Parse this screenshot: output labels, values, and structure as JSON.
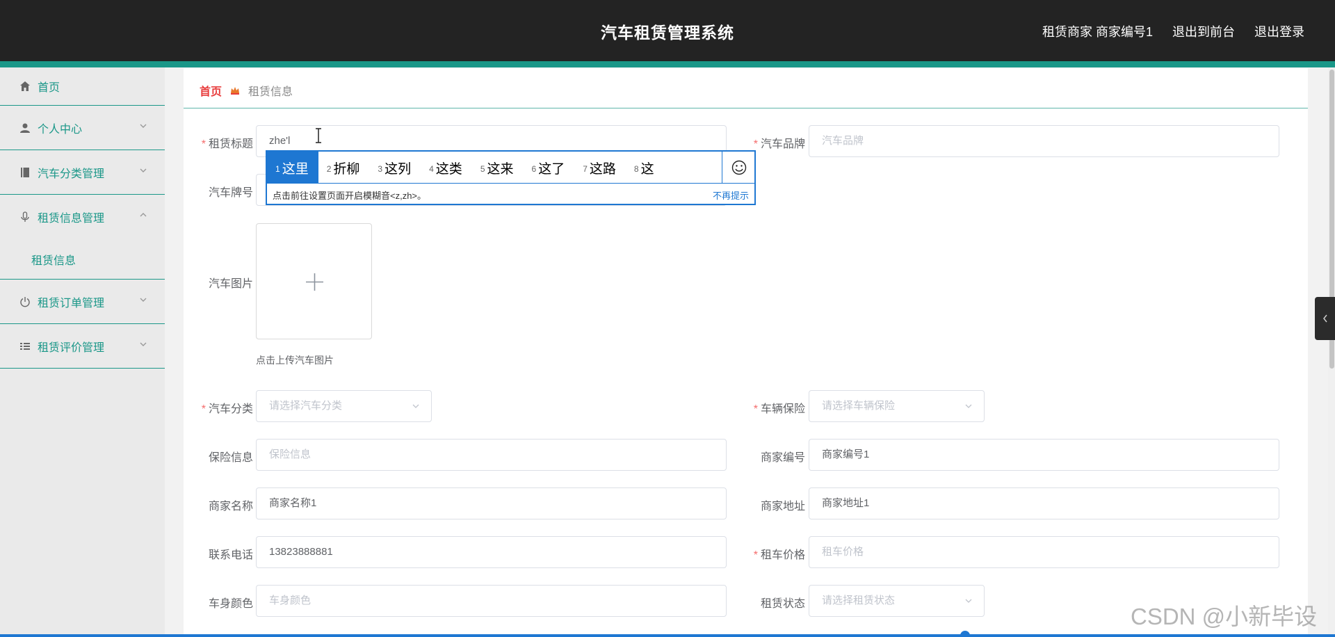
{
  "header": {
    "title": "汽车租赁管理系统",
    "user_label": "租赁商家 商家编号1",
    "to_front_label": "退出到前台",
    "logout_label": "退出登录"
  },
  "sidebar": {
    "items": [
      {
        "label": "首页",
        "icon": "home-icon"
      },
      {
        "label": "个人中心",
        "icon": "user-icon"
      },
      {
        "label": "汽车分类管理",
        "icon": "book-icon"
      },
      {
        "label": "租赁信息管理",
        "icon": "microphone-icon",
        "expanded": true,
        "children": [
          "租赁信息"
        ]
      },
      {
        "label": "租赁订单管理",
        "icon": "power-icon"
      },
      {
        "label": "租赁评价管理",
        "icon": "list-icon"
      }
    ]
  },
  "breadcrumb": {
    "home": "首页",
    "current": "租赁信息"
  },
  "form": {
    "title_label": "租赁标题",
    "title_value": "zhe'l",
    "brand_label": "汽车品牌",
    "brand_placeholder": "汽车品牌",
    "plate_label": "汽车牌号",
    "image_label": "汽车图片",
    "image_tip": "点击上传汽车图片",
    "category_label": "汽车分类",
    "category_placeholder": "请选择汽车分类",
    "insurance_label": "车辆保险",
    "insurance_placeholder": "请选择车辆保险",
    "insurance_info_label": "保险信息",
    "insurance_info_placeholder": "保险信息",
    "merchant_no_label": "商家编号",
    "merchant_no_value": "商家编号1",
    "merchant_name_label": "商家名称",
    "merchant_name_value": "商家名称1",
    "merchant_addr_label": "商家地址",
    "merchant_addr_value": "商家地址1",
    "phone_label": "联系电话",
    "phone_value": "13823888881",
    "price_label": "租车价格",
    "price_placeholder": "租车价格",
    "color_label": "车身颜色",
    "color_placeholder": "车身颜色",
    "status_label": "租赁状态",
    "status_placeholder": "请选择租赁状态"
  },
  "ime": {
    "candidates": [
      {
        "num": "1",
        "text": "这里"
      },
      {
        "num": "2",
        "text": "折柳"
      },
      {
        "num": "3",
        "text": "这列"
      },
      {
        "num": "4",
        "text": "这类"
      },
      {
        "num": "5",
        "text": "这来"
      },
      {
        "num": "6",
        "text": "这了"
      },
      {
        "num": "7",
        "text": "这路"
      },
      {
        "num": "8",
        "text": "这"
      }
    ],
    "hint": "点击前往设置页面开启模糊音<z,zh>。",
    "dismiss": "不再提示"
  },
  "watermark": "CSDN @小新毕设",
  "colors": {
    "accent": "#1a9788",
    "header_bg": "#232323",
    "ime_blue": "#1e77d2",
    "danger": "#e83c3c"
  }
}
